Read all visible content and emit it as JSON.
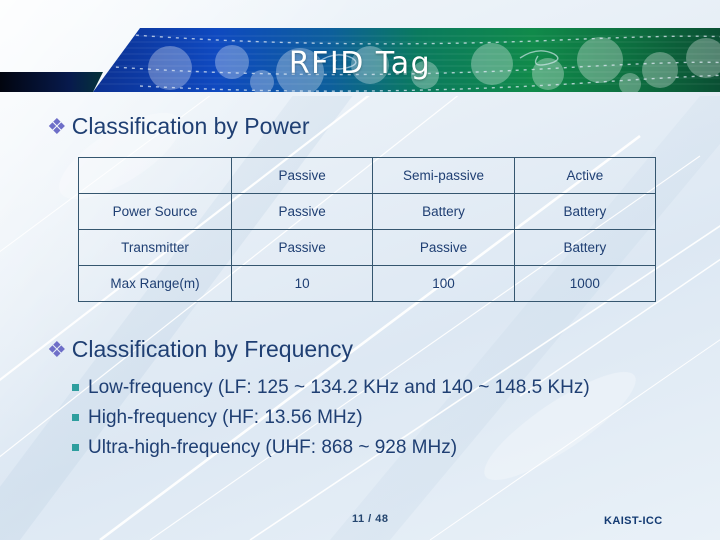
{
  "slide": {
    "title": "RFID Tag",
    "colors": {
      "heading_text": "#1f3f73",
      "diamond_bullet": "#6e6ec8",
      "square_bullet": "#2e9e9e",
      "table_border": "#35566f",
      "banner_blue": "#0b2f8f",
      "banner_green": "#0d7a46",
      "banner_dark": "#040b24",
      "footer_text": "#133a72"
    }
  },
  "sections": {
    "power": {
      "bullet_glyph": "❖",
      "heading": "Classification by Power",
      "table": {
        "columns": [
          "",
          "Passive",
          "Semi-passive",
          "Active"
        ],
        "rows": [
          {
            "label": "Power Source",
            "values": [
              "Passive",
              "Battery",
              "Battery"
            ]
          },
          {
            "label": "Transmitter",
            "values": [
              "Passive",
              "Passive",
              "Battery"
            ]
          },
          {
            "label": "Max Range(m)",
            "values": [
              "10",
              "100",
              "1000"
            ]
          }
        ]
      }
    },
    "frequency": {
      "bullet_glyph": "❖",
      "heading": "Classification by Frequency",
      "items": [
        "Low-frequency (LF: 125 ~ 134.2 KHz and 140 ~ 148.5 KHz)",
        "High-frequency (HF: 13.56 MHz)",
        "Ultra-high-frequency (UHF: 868 ~ 928 MHz)"
      ]
    }
  },
  "footer": {
    "page": "11 / 48",
    "brand": "KAIST-ICC"
  }
}
